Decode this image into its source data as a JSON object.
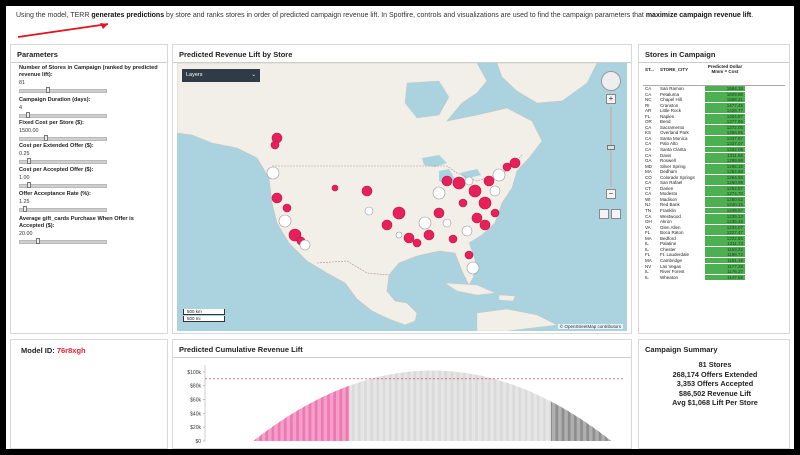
{
  "header": {
    "text_parts": [
      {
        "t": "Using the model, TERR ",
        "b": false
      },
      {
        "t": "generates predictions",
        "b": true
      },
      {
        "t": " by store and ranks stores in order of predicted campaign revenue lift. In Spotfire, controls and visualizations are used to find the campaign parameters that ",
        "b": false
      },
      {
        "t": "maximize campaign revenue lift",
        "b": true
      },
      {
        "t": ".",
        "b": false
      }
    ],
    "arrow_color": "#e3121c"
  },
  "parameters": {
    "title": "Parameters",
    "items": [
      {
        "label": "Number of Stores in Campaign (ranked by predicted revenue lift):",
        "value": "81",
        "level": 0.32
      },
      {
        "label": "Campaign Duration (days):",
        "value": "4",
        "level": 0.08
      },
      {
        "label": "Fixed Cost per Store ($):",
        "value": "1500.00",
        "level": 0.3
      },
      {
        "label": "Cost per Extended Offer ($):",
        "value": "0.25",
        "level": 0.1
      },
      {
        "label": "Cost per Accepted Offer ($):",
        "value": "1.00",
        "level": 0.1
      },
      {
        "label": "Offer Acceptance Rate (%):",
        "value": "1.25",
        "level": 0.05
      },
      {
        "label": "Average gift_cards Purchase When Offer is Accepted ($):",
        "value": "20.00",
        "level": 0.2
      }
    ]
  },
  "map": {
    "title": "Predicted Revenue Lift by Store",
    "layers_label": "Layers",
    "zoom_in": "+",
    "zoom_out": "−",
    "scale_km": "500 km",
    "scale_mi": "500 mi",
    "attribution": "© OpenStreetMap contributors",
    "marker_color": "#e8205a",
    "water_color": "#aad3df",
    "land_color": "#f2efe9"
  },
  "stores": {
    "title": "Stores in Campaign",
    "col_state": "ST...",
    "col_city": "STORE_CITY",
    "col_value": "Predicted Dollar Mmm = Cost",
    "bar_color": "#4caf50",
    "rows": [
      [
        "CA",
        "San Ramon",
        "1684.16"
      ],
      [
        "CA",
        "Petaluma",
        "1609.88"
      ],
      [
        "NC",
        "Chapel Hill",
        "1588.31"
      ],
      [
        "RI",
        "Cranston",
        "1477.45"
      ],
      [
        "AR",
        "Little Rock",
        "1425.77"
      ],
      [
        "FL",
        "Naples",
        "1404.97"
      ],
      [
        "OR",
        "Bend",
        "1377.86"
      ],
      [
        "CA",
        "Sacramento",
        "1372.06"
      ],
      [
        "KS",
        "Overland Park",
        "1356.86"
      ],
      [
        "CA",
        "Santa Monica",
        "1337.97"
      ],
      [
        "CA",
        "Palo Alto",
        "1337.07"
      ],
      [
        "CA",
        "Santa Clarita",
        "1332.05"
      ],
      [
        "CA",
        "Davis",
        "1311.65"
      ],
      [
        "GA",
        "Roswell",
        "1299.99"
      ],
      [
        "MD",
        "Silver Spring",
        "1295.15"
      ],
      [
        "MA",
        "Dedham",
        "1264.88"
      ],
      [
        "CO",
        "Colorado Springs",
        "1264.56"
      ],
      [
        "CA",
        "San Rafael",
        "1260.99"
      ],
      [
        "CT",
        "Darien",
        "1252.57"
      ],
      [
        "CA",
        "Modesto",
        "1274.70"
      ],
      [
        "WI",
        "Madison",
        "1250.62"
      ],
      [
        "NJ",
        "Red Bank",
        "1240.15"
      ],
      [
        "TN",
        "Franklin",
        "1248.57"
      ],
      [
        "CA",
        "Westwood",
        "1235.13"
      ],
      [
        "OH",
        "Akron",
        "1235.45"
      ],
      [
        "VA",
        "Glen Allen",
        "1234.07"
      ],
      [
        "FL",
        "Boca Raton",
        "1227.47"
      ],
      [
        "MA",
        "Bedford",
        "1222.86"
      ],
      [
        "IL",
        "Palatine",
        "1211.73"
      ],
      [
        "IL",
        "Chester",
        "1153.22"
      ],
      [
        "FL",
        "Ft. Lauderdale",
        "1188.72"
      ],
      [
        "MA",
        "Cambridge",
        "1181.19"
      ],
      [
        "NV",
        "Las Vegas",
        "1177.28"
      ],
      [
        "IL",
        "River Forest",
        "1176.37"
      ],
      [
        "IL",
        "Wheaton",
        "1147.56"
      ]
    ]
  },
  "model": {
    "label": "Model ID:",
    "value": "76r8xgh",
    "value_color": "#e8203c"
  },
  "cumulative": {
    "title": "Predicted Cumulative Revenue Lift",
    "y_ticks": [
      "$100k",
      "$80k",
      "$60k",
      "$40k",
      "$20k",
      "$0"
    ],
    "selected_color": "#e6338a",
    "unselected_color": "#c8c8c8"
  },
  "summary": {
    "title": "Campaign Summary",
    "lines": [
      "81 Stores",
      "268,174 Offers Extended",
      "3,353 Offers Accepted",
      "$86,502 Revenue Lift",
      "Avg $1,068 Lift Per Store"
    ]
  },
  "chart_data": {
    "type": "bar",
    "title": "Predicted Cumulative Revenue Lift",
    "ylim": [
      0,
      110000
    ],
    "y_tick_values": [
      0,
      20000,
      40000,
      60000,
      80000,
      100000
    ],
    "y_tick_labels": [
      "$0",
      "$20k",
      "$40k",
      "$60k",
      "$80k",
      "$100k"
    ],
    "reference_line": 90000,
    "n_bars": 300,
    "n_selected": 81,
    "peak_value": 102000,
    "peak_index": 150
  }
}
